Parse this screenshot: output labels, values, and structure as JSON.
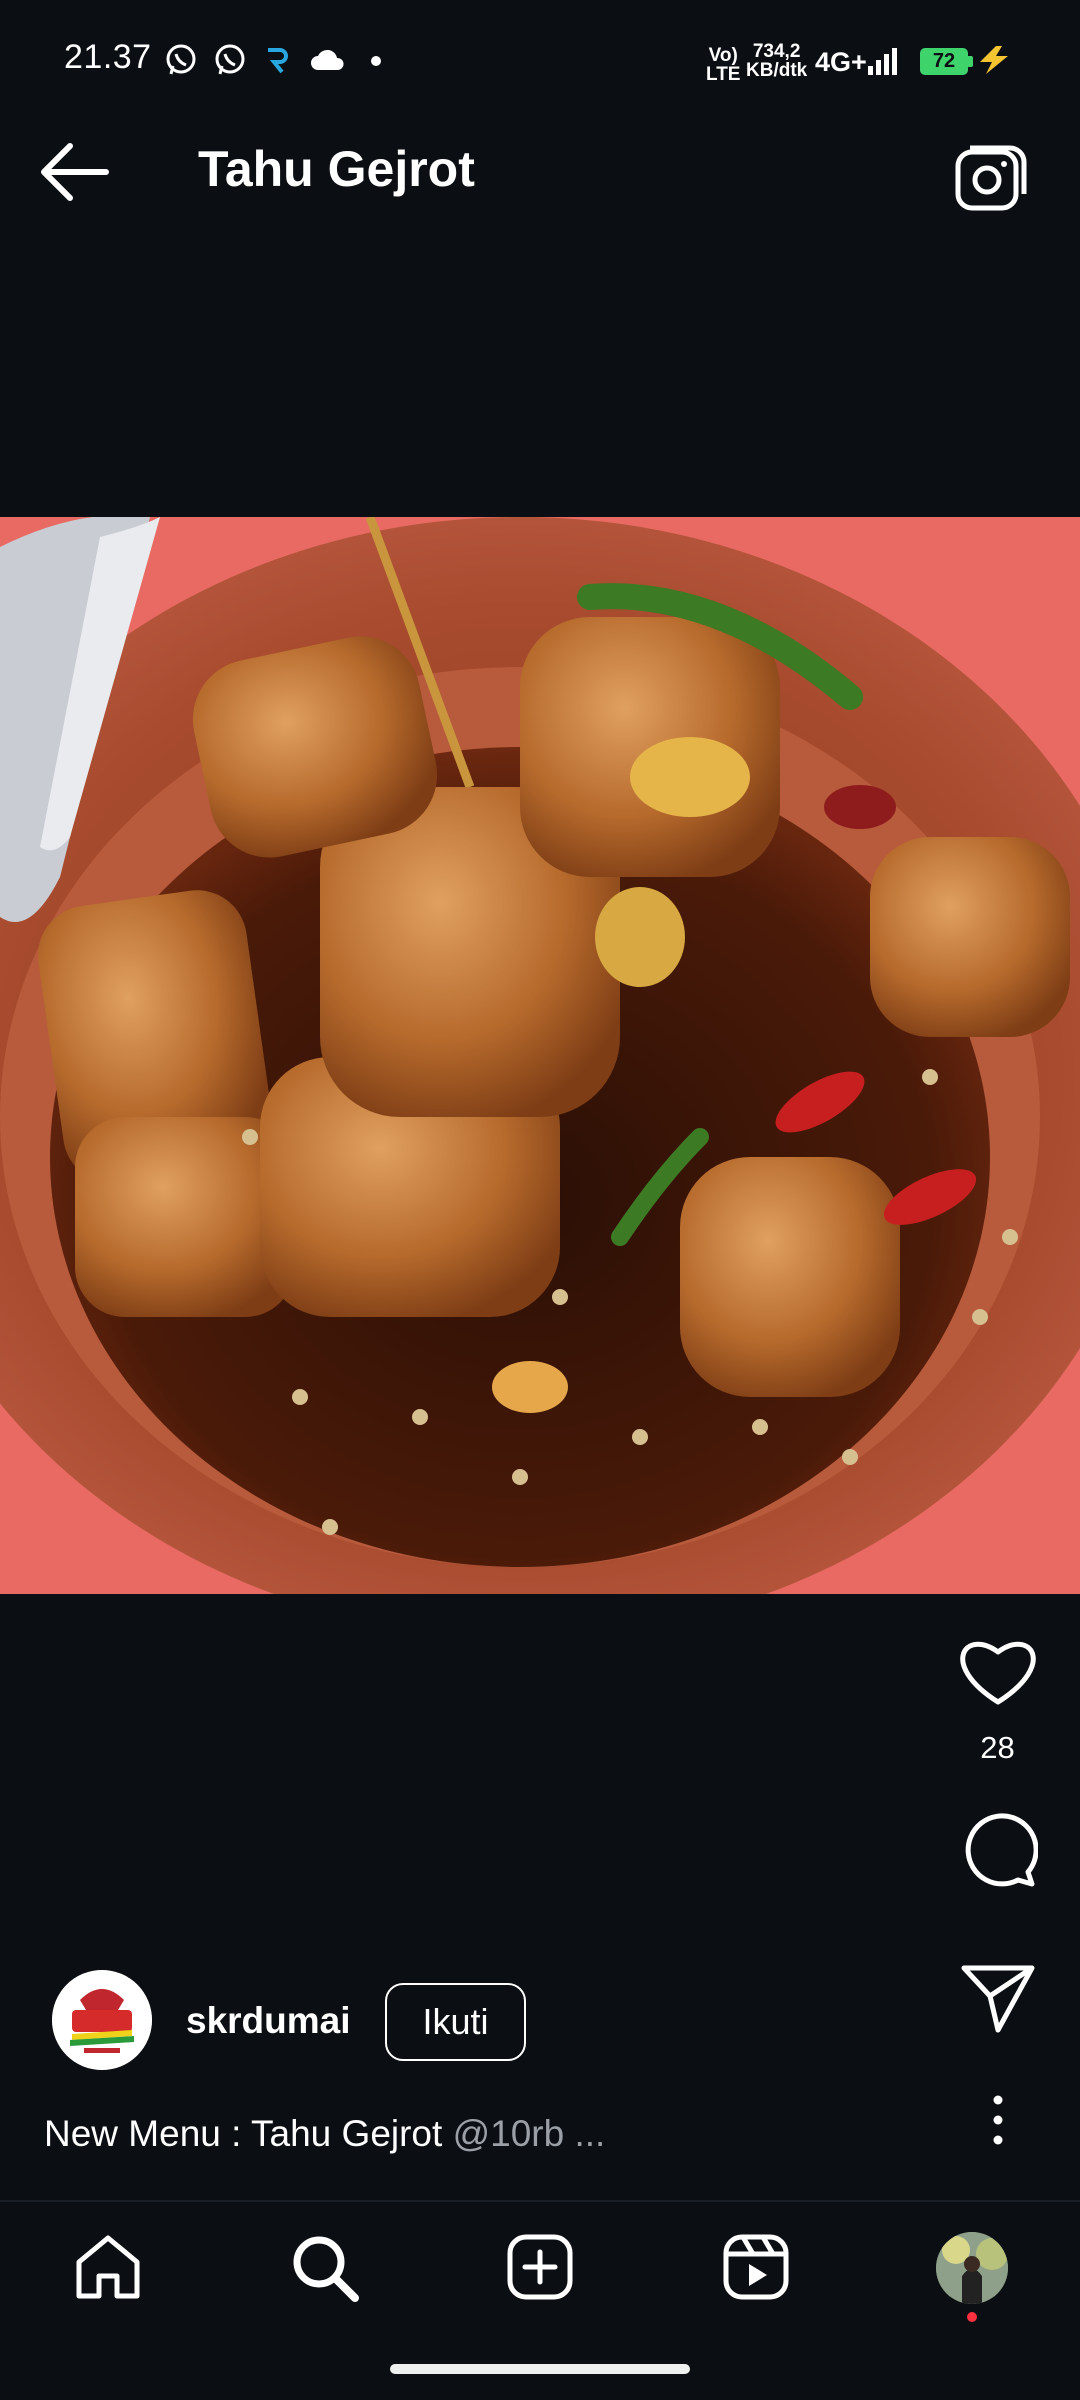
{
  "status_bar": {
    "time": "21.37",
    "volte_top": "Vo)",
    "volte_bottom": "LTE",
    "speed_value": "734,2",
    "speed_unit": "KB/dtk",
    "network": "4G+",
    "battery": "72",
    "icons": [
      "whatsapp-icon",
      "whatsapp-icon",
      "app-icon",
      "cloud-icon",
      "dot-icon",
      "signal-icon",
      "battery-icon",
      "charging-icon"
    ]
  },
  "header": {
    "title": "Tahu Gejrot",
    "back_icon": "arrow-left-icon",
    "camera_icon": "camera-icon"
  },
  "post": {
    "image_subject": "tahu-gejrot-food-photo",
    "like_count": "28",
    "author": {
      "username": "skrdumai",
      "follow_label": "Ikuti"
    },
    "caption": {
      "text": "New Menu : Tahu Gejrot ",
      "more": "@10rb ..."
    }
  },
  "nav": {
    "items": [
      "home-icon",
      "search-icon",
      "add-icon",
      "reels-icon",
      "profile-avatar"
    ]
  },
  "colors": {
    "background": "#0b0f14",
    "text": "#ffffff",
    "muted": "#9aa0a6",
    "battery": "#3fd36c",
    "notification_dot": "#ff3040"
  }
}
